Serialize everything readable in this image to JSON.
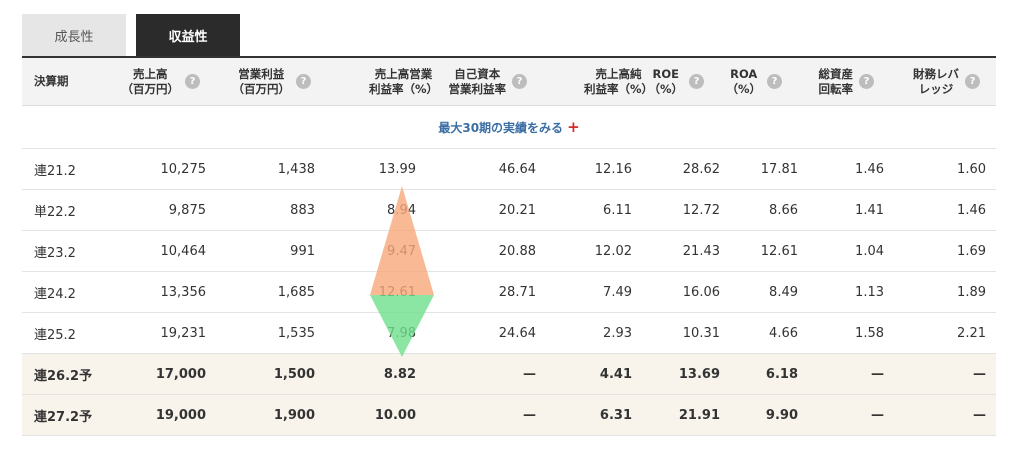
{
  "tabs": [
    {
      "label": "成長性",
      "active": false
    },
    {
      "label": "収益性",
      "active": true
    }
  ],
  "columns": [
    {
      "label": "決算期",
      "help": false
    },
    {
      "label": "売上高\n（百万円）",
      "help": true
    },
    {
      "label": "営業利益\n（百万円）",
      "help": true
    },
    {
      "label": "売上高営業\n利益率（%）",
      "help": false
    },
    {
      "label": "自己資本\n営業利益率",
      "help": true
    },
    {
      "label": "売上高純\n利益率（%）",
      "help": false
    },
    {
      "label": "ROE\n（%）",
      "help": true
    },
    {
      "label": "ROA\n（%）",
      "help": true
    },
    {
      "label": "総資産\n回転率",
      "help": true
    },
    {
      "label": "財務レバ\nレッジ",
      "help": true
    }
  ],
  "help_icon": "?",
  "more_link": {
    "label": "最大30期の実績をみる",
    "icon": "+"
  },
  "rows": [
    {
      "forecast": false,
      "cells": [
        "連21.2",
        "10,275",
        "1,438",
        "13.99",
        "46.64",
        "12.16",
        "28.62",
        "17.81",
        "1.46",
        "1.60"
      ]
    },
    {
      "forecast": false,
      "cells": [
        "単22.2",
        "9,875",
        "883",
        "8.94",
        "20.21",
        "6.11",
        "12.72",
        "8.66",
        "1.41",
        "1.46"
      ]
    },
    {
      "forecast": false,
      "cells": [
        "連23.2",
        "10,464",
        "991",
        "9.47",
        "20.88",
        "12.02",
        "21.43",
        "12.61",
        "1.04",
        "1.69"
      ]
    },
    {
      "forecast": false,
      "cells": [
        "連24.2",
        "13,356",
        "1,685",
        "12.61",
        "28.71",
        "7.49",
        "16.06",
        "8.49",
        "1.13",
        "1.89"
      ]
    },
    {
      "forecast": false,
      "cells": [
        "連25.2",
        "19,231",
        "1,535",
        "7.98",
        "24.64",
        "2.93",
        "10.31",
        "4.66",
        "1.58",
        "2.21"
      ]
    },
    {
      "forecast": true,
      "cells": [
        "連26.2予",
        "17,000",
        "1,500",
        "8.82",
        "—",
        "4.41",
        "13.69",
        "6.18",
        "—",
        "—"
      ]
    },
    {
      "forecast": true,
      "cells": [
        "連27.2予",
        "19,000",
        "1,900",
        "10.00",
        "—",
        "6.31",
        "21.91",
        "9.90",
        "—",
        "—"
      ]
    }
  ],
  "colors": {
    "up_marker": "#f6a879",
    "down_marker": "#6fe08c",
    "forecast_row_bg": "#f8f4eb",
    "link": "#3a6ea5",
    "plus": "#d62b2b"
  }
}
